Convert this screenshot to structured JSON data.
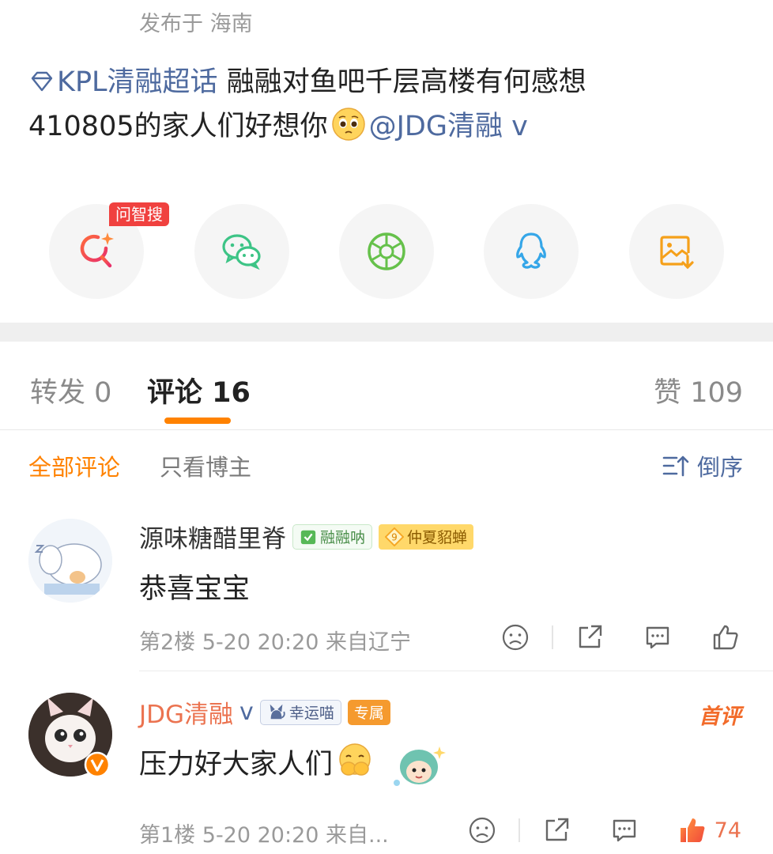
{
  "post": {
    "location": "发布于 海南",
    "topic": "KPL清融超话",
    "text_line1": " 融融对鱼吧千层高楼有何感想",
    "text_line2": "410805的家人们好想你",
    "mention": "@JDG清融",
    "mention_v": "v"
  },
  "share": {
    "ask_badge": "问智搜",
    "buttons": [
      "ask-search",
      "wechat",
      "moments",
      "qq",
      "save-image"
    ]
  },
  "tabs": {
    "repost": "转发 0",
    "comments": "评论 16",
    "likes": "赞 109"
  },
  "filters": {
    "all": "全部评论",
    "blogger_only": "只看博主",
    "sort": "倒序"
  },
  "comments": [
    {
      "name": "源味糖醋里脊",
      "badge1": "融融呐",
      "badge2_level": "9",
      "badge2": "仲夏貂蝉",
      "text": "恭喜宝宝",
      "meta": "第2楼 5-20 20:20 来自辽宁",
      "likes": ""
    },
    {
      "name": "JDG清融",
      "name_v": "v",
      "badge1": "幸运喵",
      "badge2": "专属",
      "first_review": "首评",
      "text": "压力好大家人们",
      "meta": "第1楼 5-20 20:20 来自...",
      "likes": "74"
    }
  ],
  "colors": {
    "accent": "#ff8200",
    "link": "#4e6a9f",
    "vip_name": "#eb7350",
    "badge_red": "#f0413f"
  }
}
